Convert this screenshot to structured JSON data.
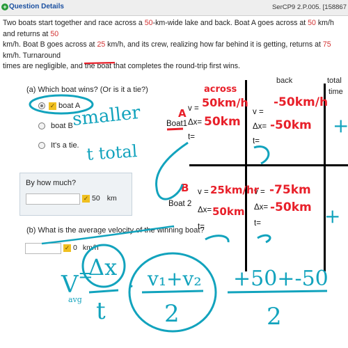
{
  "header": {
    "title": "Question Details",
    "code": "SerCP9 2.P.005. [158867"
  },
  "problem": {
    "line1": {
      "t1": "Two boats start together and race across a ",
      "r1": "50",
      "t2": "-km-wide lake and back. Boat A goes across at ",
      "r2": "50",
      "t3": " km/h and returns at ",
      "r3": "50"
    },
    "line2": {
      "t1": "km/h. Boat B goes across at ",
      "r1": "25",
      "t2": " km/h, and its crew, realizing how far behind it is getting, returns at ",
      "r2": "75",
      "t3": " km/h. Turnaround"
    },
    "line3": "times are negligible, and the boat that completes the round-trip first wins."
  },
  "part_a": {
    "question": "(a) Which boat wins? (Or is it a tie?)",
    "options": [
      "boat A",
      "boat B",
      "It's a tie."
    ],
    "selected": "boat A"
  },
  "how_much": {
    "label": "By how much?",
    "value": "50",
    "unit": "km"
  },
  "part_b": {
    "question": "(b) What is the average velocity of the winning boat?",
    "value": "0",
    "unit": "km/h"
  },
  "table": {
    "col_back": "back",
    "col_total_1": "total",
    "col_total_2": "time",
    "boat1": "Boat1",
    "boat2": "Boat 2",
    "v": "v =",
    "dx": "Δx=",
    "t": "t="
  },
  "annotations": {
    "across": "across",
    "a1_v": "50km/h",
    "a1_dx": "50km",
    "back_v1": "-50km/h",
    "back_dx1": "-50km",
    "a2_v": "25km/hr",
    "a2_dx": "50km",
    "back_v2": "-75km",
    "back_dx2": "-50km",
    "smaller": "smaller",
    "total": "t total",
    "label_A": "A",
    "label_B": "B",
    "plus": "+",
    "formula_v": "V",
    "formula_avg": "avg",
    "formula_eq": "=",
    "formula_dx": "Δx",
    "formula_t": "t",
    "formula_v1v2": "v₁+v₂",
    "formula_2": "2",
    "formula_nums": "+50+-50",
    "formula_2b": "2"
  }
}
